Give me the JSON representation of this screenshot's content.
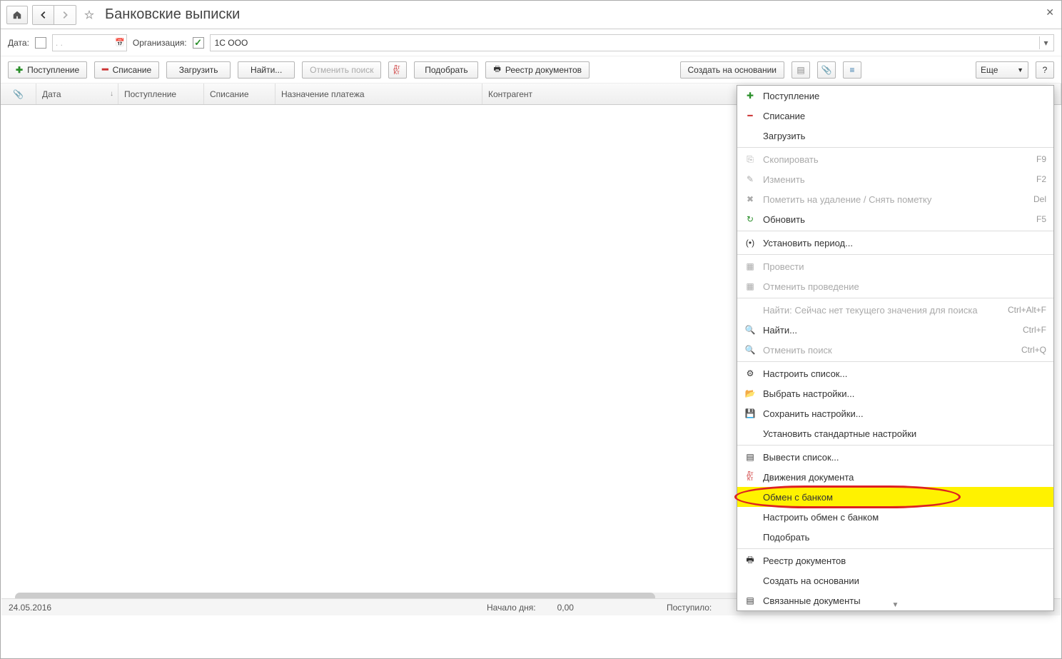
{
  "title": "Банковские выписки",
  "filter": {
    "date_label": "Дата:",
    "date_value": ".   .",
    "org_label": "Организация:",
    "org_value": "1С ООО"
  },
  "toolbar": {
    "income": "Поступление",
    "expense": "Списание",
    "load": "Загрузить",
    "find": "Найти...",
    "cancel_find": "Отменить поиск",
    "pick": "Подобрать",
    "registry": "Реестр документов",
    "create_based": "Создать на основании",
    "more": "Еще"
  },
  "columns": {
    "attach": "",
    "date": "Дата",
    "income": "Поступление",
    "expense": "Списание",
    "purpose": "Назначение платежа",
    "counterparty": "Контрагент"
  },
  "status": {
    "date": "24.05.2016",
    "day_start_label": "Начало дня:",
    "day_start_value": "0,00",
    "received_label": "Поступило:"
  },
  "menu": {
    "income": "Поступление",
    "expense": "Списание",
    "load": "Загрузить",
    "copy": "Скопировать",
    "copy_sc": "F9",
    "edit": "Изменить",
    "edit_sc": "F2",
    "mark_delete": "Пометить на удаление / Снять пометку",
    "mark_delete_sc": "Del",
    "refresh": "Обновить",
    "refresh_sc": "F5",
    "set_period": "Установить период...",
    "post": "Провести",
    "unpost": "Отменить проведение",
    "find_hint": "Найти: Сейчас нет текущего значения для поиска",
    "find_hint_sc": "Ctrl+Alt+F",
    "find": "Найти...",
    "find_sc": "Ctrl+F",
    "cancel_find": "Отменить поиск",
    "cancel_find_sc": "Ctrl+Q",
    "configure_list": "Настроить список...",
    "choose_settings": "Выбрать настройки...",
    "save_settings": "Сохранить настройки...",
    "default_settings": "Установить стандартные настройки",
    "output_list": "Вывести список...",
    "doc_movements": "Движения документа",
    "bank_exchange": "Обмен с банком",
    "configure_bank": "Настроить обмен с банком",
    "pick": "Подобрать",
    "registry": "Реестр документов",
    "create_based": "Создать на основании",
    "related_docs": "Связанные документы"
  }
}
